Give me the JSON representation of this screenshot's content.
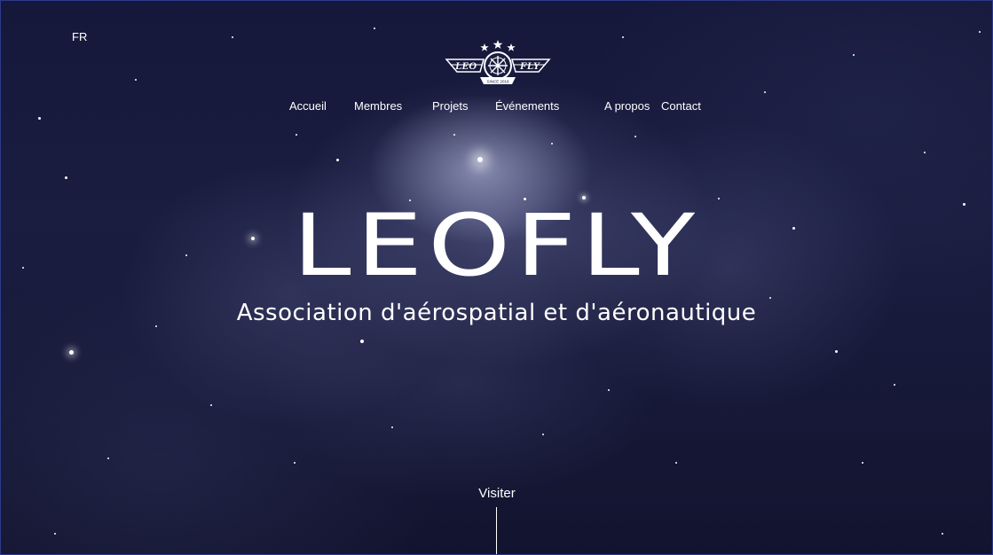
{
  "lang_switch": "FR",
  "logo": {
    "left_text": "LEO",
    "right_text": "FLY",
    "tagline": "SINCE 2018"
  },
  "nav": {
    "items": [
      {
        "label": "Accueil"
      },
      {
        "label": "Membres"
      },
      {
        "label": "Projets"
      },
      {
        "label": "Événements"
      },
      {
        "label": "A propos"
      },
      {
        "label": "Contact"
      }
    ]
  },
  "hero": {
    "title": "LEOFLY",
    "subtitle": "Association d'aérospatial et d'aéronautique"
  },
  "cta": {
    "label": "Visiter"
  }
}
